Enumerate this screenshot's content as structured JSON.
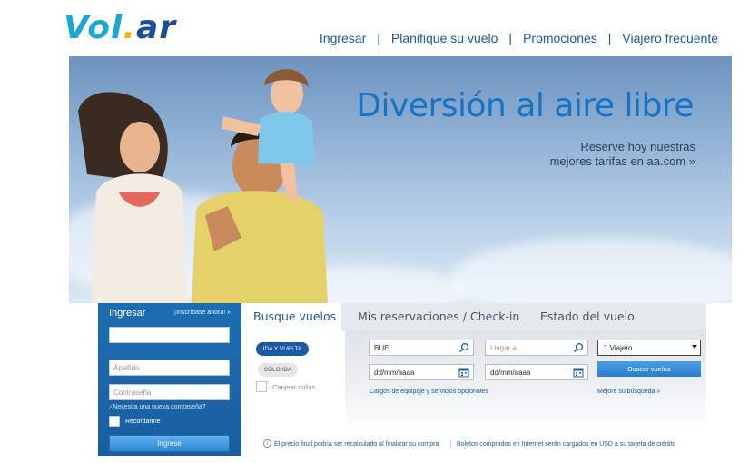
{
  "logo": {
    "part1": "Vol",
    "dot": ".",
    "part2": "ar"
  },
  "topnav": {
    "items": [
      "Ingresar",
      "Planifique su vuelo",
      "Promociones",
      "Viajero frecuente"
    ],
    "separator": "|"
  },
  "hero": {
    "title": "Diversión al aire libre",
    "subtitle_line1": "Reserve hoy nuestras",
    "subtitle_line2": "mejores tarifas en aa.com »"
  },
  "login": {
    "title": "Ingresar",
    "signup_link": "¡Inscríbase ahora! »",
    "field1_value": "",
    "lastname_placeholder": "Apellido",
    "password_placeholder": "Contraseña",
    "forgot_link": "¿Necesita una nueva contraseña?",
    "remember_label": "Recordarme",
    "submit_label": "Ingrese"
  },
  "booking": {
    "tabs": [
      "Busque vuelos",
      "Mis reservaciones / Check-in",
      "Estado del vuelo"
    ],
    "active_tab": "Busque vuelos",
    "trip_round": "IDA Y VUELTA",
    "trip_oneway": "SÓLO IDA",
    "miles_label": "Canjear millas",
    "origin_value": "BUE",
    "destination_placeholder": "Llegar a",
    "depart_date": "dd/mm/aaaa",
    "return_date": "dd/mm/aaaa",
    "travelers_selected": "1 Viajero",
    "search_button": "Buscar vuelos",
    "baggage_link": "Cargos de equipaje y servicios opcionales",
    "best_search_link": "Mejore su búsqueda »",
    "note1": "El precio final podría ser recalculado al finalizar su compra",
    "note2": "Boletos comprados en Internet serán cargados en USD a su tarjeta de crédito"
  },
  "colors": {
    "brand_blue": "#1a5aa6",
    "logo_cyan": "#1aa7d6",
    "logo_dot": "#f4b400",
    "hero_title": "#1673c5"
  },
  "icons": [
    "search-icon",
    "calendar-icon",
    "chevron-down-icon",
    "info-icon"
  ]
}
